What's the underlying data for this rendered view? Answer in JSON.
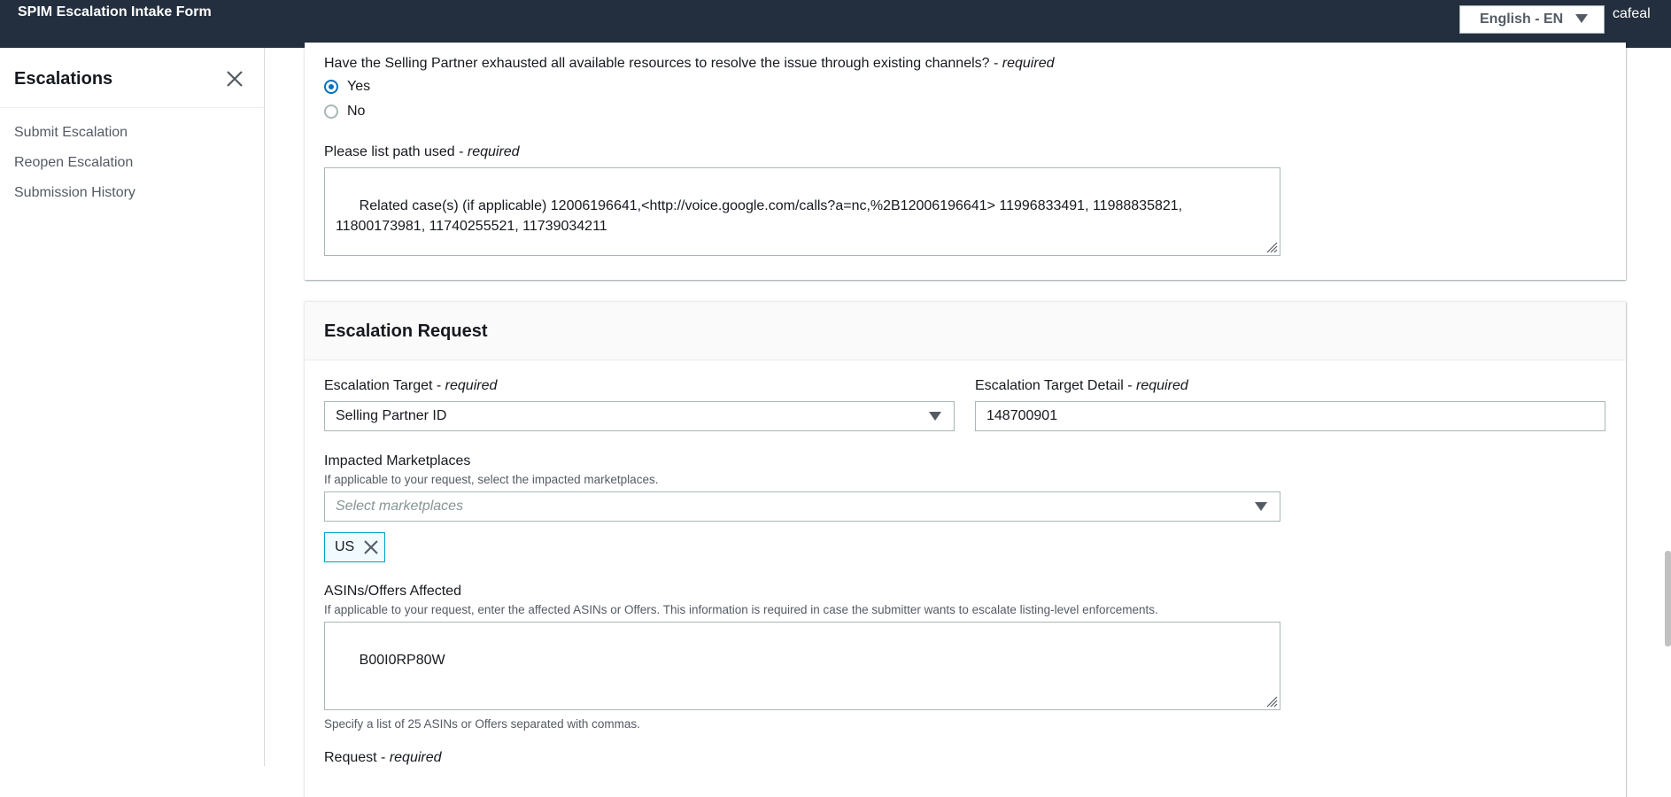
{
  "header": {
    "app_title": "SPIM Escalation Intake Form",
    "language": "English - EN",
    "user": "cafeal"
  },
  "sidebar": {
    "title": "Escalations",
    "items": [
      {
        "label": "Submit Escalation"
      },
      {
        "label": "Reopen Escalation"
      },
      {
        "label": "Submission History"
      }
    ]
  },
  "resources_section": {
    "exhausted_question": "Have the Selling Partner exhausted all available resources to resolve the issue through existing channels? -",
    "required_text": "required",
    "options": [
      {
        "label": "Yes",
        "checked": true
      },
      {
        "label": "No",
        "checked": false
      }
    ],
    "path_label": "Please list path used -",
    "path_value": "Related case(s) (if applicable) 12006196641,<http://voice.google.com/calls?a=nc,%2B12006196641> 11996833491, 11988835821,\n11800173981, 11740255521, 11739034211"
  },
  "escalation_request": {
    "title": "Escalation Request",
    "target_label": "Escalation Target -",
    "target_value": "Selling Partner ID",
    "target_detail_label": "Escalation Target Detail -",
    "target_detail_value": "148700901",
    "marketplaces_label": "Impacted Marketplaces",
    "marketplaces_desc": "If applicable to your request, select the impacted marketplaces.",
    "marketplaces_placeholder": "Select marketplaces",
    "selected_marketplaces": [
      "US"
    ],
    "asins_label": "ASINs/Offers Affected",
    "asins_desc": "If applicable to your request, enter the affected ASINs or Offers. This information is required in case the submitter wants to escalate listing-level enforcements.",
    "asins_value": "B00I0RP80W",
    "asins_hint": "Specify a list of 25 ASINs or Offers separated with commas.",
    "request_label": "Request -",
    "required_text": "required"
  }
}
